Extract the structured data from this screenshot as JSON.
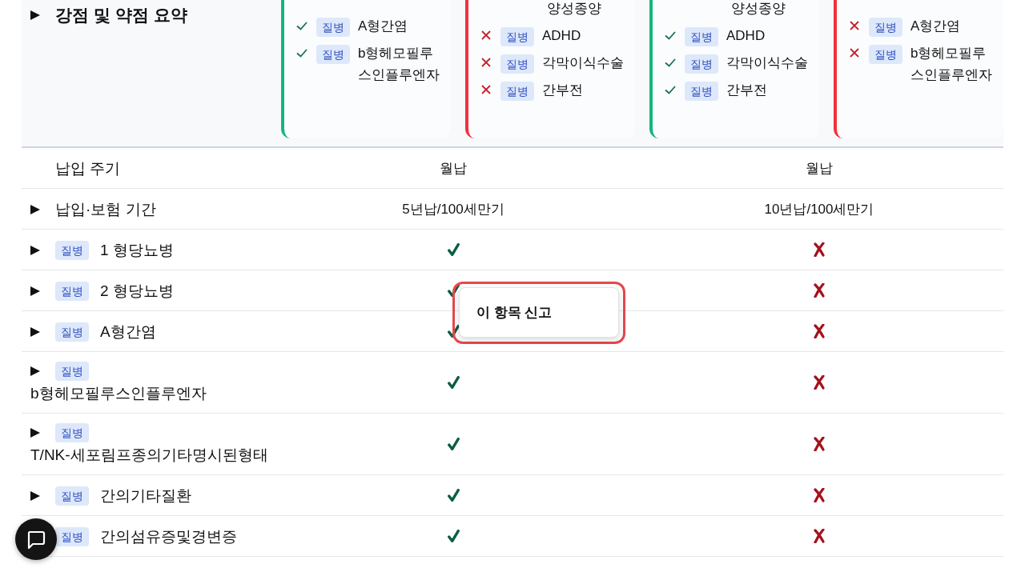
{
  "summary": {
    "title": "강점 및 약점 요약",
    "expandable": true,
    "cards": [
      {
        "positive": true,
        "items": [
          {
            "kind": "item",
            "covered": true,
            "tag": "질병",
            "text": "A형간염"
          },
          {
            "kind": "item",
            "covered": true,
            "tag": "질병",
            "text": "b형헤모필루스인플루엔자"
          }
        ]
      },
      {
        "positive": false,
        "items": [
          {
            "kind": "tail",
            "text": "양성종양"
          },
          {
            "kind": "item",
            "covered": false,
            "tag": "질병",
            "text": "ADHD"
          },
          {
            "kind": "item",
            "covered": false,
            "tag": "질병",
            "text": "각막이식수술"
          },
          {
            "kind": "item",
            "covered": false,
            "tag": "질병",
            "text": "간부전"
          }
        ]
      },
      {
        "positive": true,
        "items": [
          {
            "kind": "tail",
            "text": "양성종양"
          },
          {
            "kind": "item",
            "covered": true,
            "tag": "질병",
            "text": "ADHD"
          },
          {
            "kind": "item",
            "covered": true,
            "tag": "질병",
            "text": "각막이식수술"
          },
          {
            "kind": "item",
            "covered": true,
            "tag": "질병",
            "text": "간부전"
          }
        ]
      },
      {
        "positive": false,
        "items": [
          {
            "kind": "item",
            "covered": false,
            "tag": "질병",
            "text": "A형간염"
          },
          {
            "kind": "item",
            "covered": false,
            "tag": "질병",
            "text": "b형헤모필루스인플루엔자"
          }
        ]
      }
    ]
  },
  "table": {
    "rows": [
      {
        "expandable": false,
        "label": "납입 주기",
        "cells": [
          {
            "kind": "text",
            "text": "월납"
          },
          {
            "kind": "text",
            "text": "월납"
          }
        ]
      },
      {
        "expandable": true,
        "label": "납입·보험 기간",
        "cells": [
          {
            "kind": "text",
            "text": "5년납/100세만기"
          },
          {
            "kind": "text",
            "text": "10년납/100세만기"
          }
        ]
      },
      {
        "expandable": true,
        "tag": "질병",
        "label": "1 형당뇨병",
        "cells": [
          {
            "kind": "check"
          },
          {
            "kind": "cross"
          }
        ]
      },
      {
        "expandable": true,
        "tag": "질병",
        "label": "2 형당뇨병",
        "cells": [
          {
            "kind": "check"
          },
          {
            "kind": "cross"
          }
        ]
      },
      {
        "expandable": true,
        "tag": "질병",
        "label": "A형간염",
        "cells": [
          {
            "kind": "check"
          },
          {
            "kind": "cross"
          }
        ]
      },
      {
        "expandable": true,
        "tag": "질병",
        "label": "b형헤모필루스인플루엔자",
        "cells": [
          {
            "kind": "check"
          },
          {
            "kind": "cross"
          }
        ]
      },
      {
        "expandable": true,
        "tag": "질병",
        "label": "T/NK-세포림프종의기타명시된형태",
        "cells": [
          {
            "kind": "check"
          },
          {
            "kind": "cross"
          }
        ]
      },
      {
        "expandable": true,
        "tag": "질병",
        "label": "간의기타질환",
        "cells": [
          {
            "kind": "check"
          },
          {
            "kind": "cross"
          }
        ]
      },
      {
        "tag": "질병",
        "label": "간의섬유증및경변증",
        "cells": [
          {
            "kind": "check"
          },
          {
            "kind": "cross"
          }
        ]
      }
    ]
  },
  "popup": {
    "label": "이 항목 신고"
  }
}
